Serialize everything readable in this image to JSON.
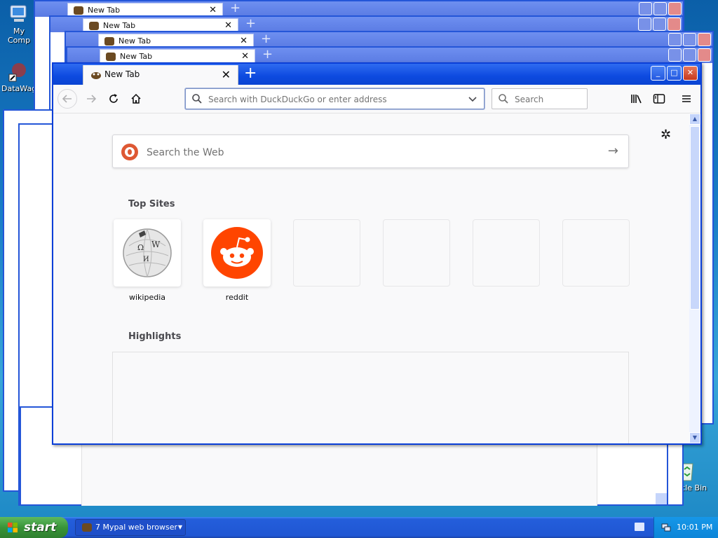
{
  "desktop": {
    "icons": [
      {
        "label": "My Comp"
      },
      {
        "label": "DataWag"
      },
      {
        "label": "ecycle Bin"
      }
    ]
  },
  "background_windows": [
    {
      "tab_title": "New Tab"
    },
    {
      "tab_title": "New Tab"
    },
    {
      "tab_title": "New Tab"
    },
    {
      "tab_title": "New Tab"
    }
  ],
  "browser": {
    "tab": {
      "title": "New Tab",
      "close": "✕"
    },
    "new_tab": "+",
    "window_buttons": {
      "minimize": "_",
      "maximize": "□",
      "close": "✕"
    },
    "urlbar": {
      "placeholder": "Search with DuckDuckGo or enter address",
      "value": ""
    },
    "searchbar": {
      "placeholder": "Search",
      "value": ""
    },
    "toolbar_icons": [
      "back-icon",
      "forward-icon",
      "reload-icon",
      "home-icon",
      "library-icon",
      "sidebar-icon",
      "menu-icon"
    ]
  },
  "newtab": {
    "web_search": {
      "placeholder": "Search the Web",
      "arrow": "→"
    },
    "top_sites_title": "Top Sites",
    "top_sites": [
      {
        "label": "wikipedia"
      },
      {
        "label": "reddit"
      },
      {
        "label": ""
      },
      {
        "label": ""
      },
      {
        "label": ""
      },
      {
        "label": ""
      }
    ],
    "highlights_title": "Highlights"
  },
  "taskbar": {
    "start_label": "start",
    "task_button": "7 Mypal web browser",
    "clock": "10:01 PM"
  },
  "colors": {
    "titlebar": "#0d4ae0",
    "reddit": "#ff4500",
    "duckduckgo": "#de5833",
    "taskbar": "#245edb",
    "start": "#389438"
  }
}
